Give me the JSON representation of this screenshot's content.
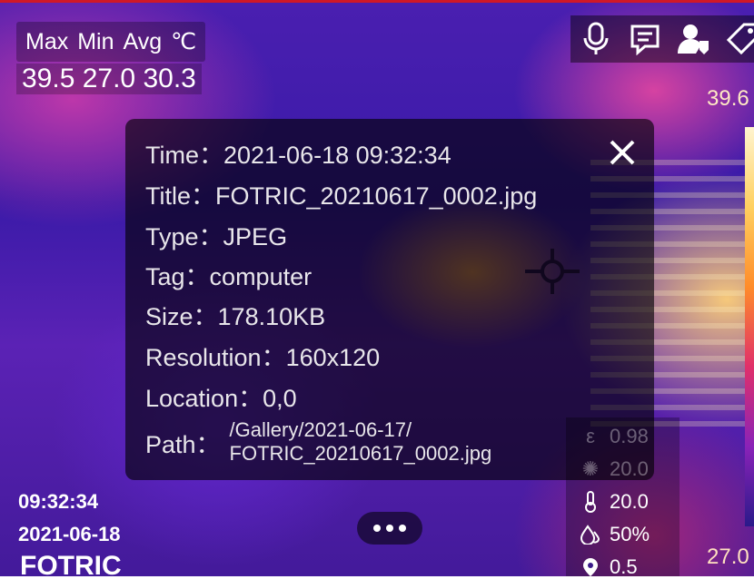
{
  "measurement": {
    "labels": [
      "Max",
      "Min",
      "Avg"
    ],
    "unit": "℃",
    "values": "39.5 27.0 30.3"
  },
  "scale": {
    "max": "39.6",
    "min": "27.0"
  },
  "toolbar": {
    "icons": [
      "microphone-icon",
      "text-note-icon",
      "person-tag-icon",
      "price-tag-icon"
    ]
  },
  "info": {
    "time_label": "Time：",
    "time": "2021-06-18 09:32:34",
    "title_label": "Title：",
    "title": "FOTRIC_20210617_0002.jpg",
    "type_label": "Type：",
    "type": "JPEG",
    "tag_label": "Tag：",
    "tag": "computer",
    "size_label": "Size：",
    "size": "178.10KB",
    "resolution_label": "Resolution：",
    "resolution": "160x120",
    "location_label": "Location：",
    "location": "0,0",
    "path_label": "Path：",
    "path_line1": "/Gallery/2021-06-17/",
    "path_line2": "FOTRIC_20210617_0002.jpg"
  },
  "params": {
    "emissivity": "0.98",
    "reflected_temp": "20.0",
    "ambient_temp": "20.0",
    "humidity": "50%",
    "distance": "0.5"
  },
  "footer": {
    "time": "09:32:34",
    "date": "2021-06-18",
    "brand": "FOTRIC"
  },
  "colors": {
    "accent_red": "#d01828",
    "panel_bg": "rgba(0,0,0,0.62)"
  }
}
